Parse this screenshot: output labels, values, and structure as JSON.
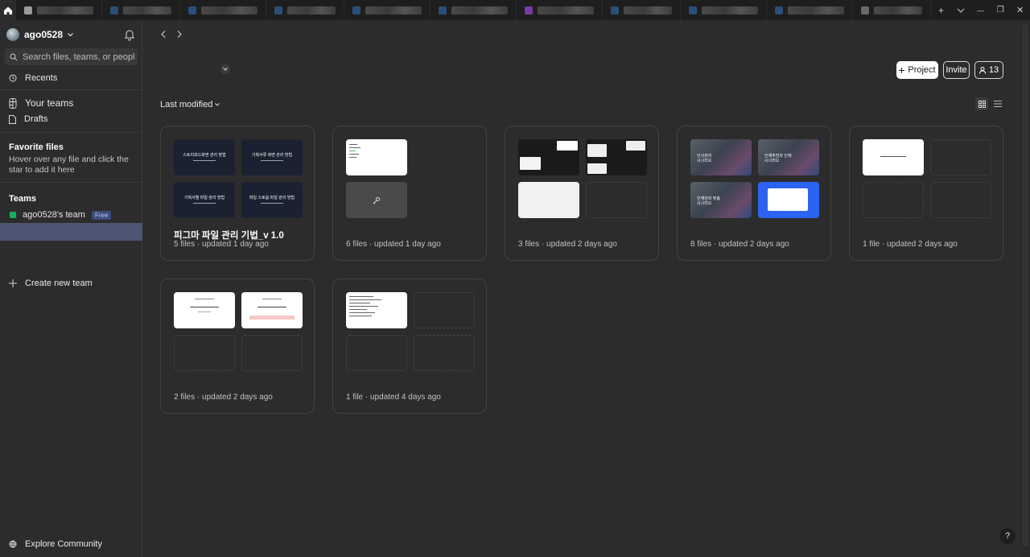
{
  "titlebar": {
    "tabs": [
      {
        "color": "#9a9a9a",
        "width": 70
      },
      {
        "color": "#2a4f7a",
        "width": 60
      },
      {
        "color": "#2a4f7a",
        "width": 70
      },
      {
        "color": "#2a4f7a",
        "width": 60
      },
      {
        "color": "#2a4f7a",
        "width": 70
      },
      {
        "color": "#2a4f7a",
        "width": 70
      },
      {
        "color": "#7a3aa3",
        "width": 70
      },
      {
        "color": "#2a4f7a",
        "width": 60
      },
      {
        "color": "#2a4f7a",
        "width": 70
      },
      {
        "color": "#2a4f7a",
        "width": 70
      },
      {
        "color": "#6a6a6a",
        "width": 60
      }
    ],
    "new_tab": "+",
    "minimize": "—",
    "maximize": "❐",
    "close": "✕"
  },
  "sidebar": {
    "username": "ago0528",
    "search_placeholder": "Search files, teams, or people",
    "recents": "Recents",
    "your_teams": "Your teams",
    "drafts": "Drafts",
    "favorite_title": "Favorite files",
    "favorite_help": "Hover over any file and click the star to add it here",
    "teams_title": "Teams",
    "team_name": "ago0528's team",
    "team_badge": "Free",
    "create_team": "Create new team",
    "explore": "Explore Community"
  },
  "toolbar": {
    "project_label": "Project",
    "invite_label": "Invite",
    "members_count": "13",
    "sort_label": "Last modified"
  },
  "projects": [
    {
      "name": "피그마 파일 관리 기법_v 1.0",
      "meta": "5 files · updated 1 day ago"
    },
    {
      "name": "",
      "meta": "6 files · updated 1 day ago"
    },
    {
      "name": "",
      "meta": "3 files · updated 2 days ago"
    },
    {
      "name": "",
      "meta": "8 files · updated 2 days ago"
    },
    {
      "name": "",
      "meta": "1 file · updated 2 days ago"
    },
    {
      "name": "",
      "meta": "2 files · updated 2 days ago"
    },
    {
      "name": "",
      "meta": "1 file · updated 4 days ago"
    }
  ],
  "thumb_text": {
    "p1": [
      "스토리보드화면 관리 방법",
      "기획서류 화면 관리 방법",
      "기획서별 파일 관리 방법",
      "파일 스토봄 파일 관리 방법"
    ],
    "p4": [
      "인사관리\n시나리오",
      "인재추천과 인재\n시나리오",
      "인재관리 맞춤\n시나리오"
    ]
  },
  "help": "?"
}
